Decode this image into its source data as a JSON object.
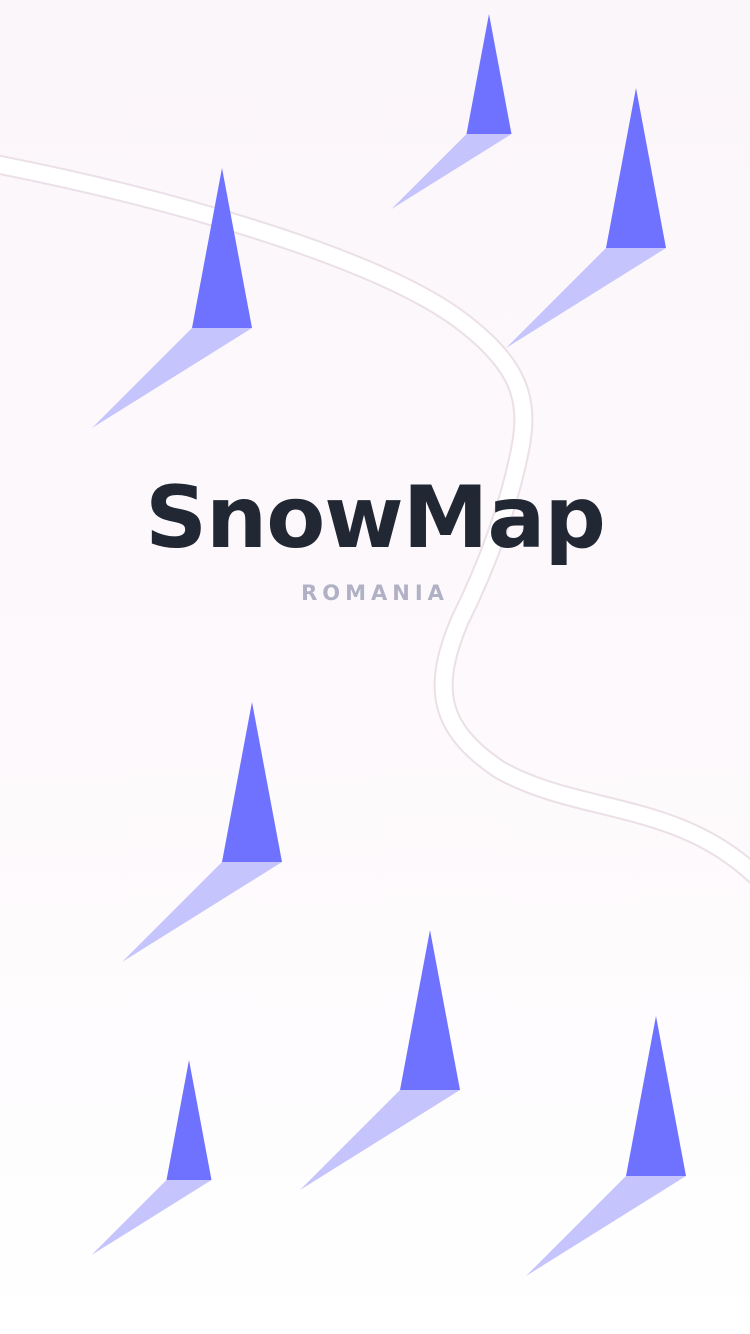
{
  "app": {
    "title": "SnowMap",
    "subtitle": "ROMANIA"
  },
  "colors": {
    "title": "#222833",
    "subtitle": "#b0b1c4",
    "arrow_dark": "#6e72ff",
    "arrow_light": "#c6c4fc",
    "trail_white": "#ffffff",
    "trail_edge": "#ebe0e7"
  },
  "icons": {
    "decoration": "ski-arrow-icon",
    "path": "ski-trail"
  }
}
